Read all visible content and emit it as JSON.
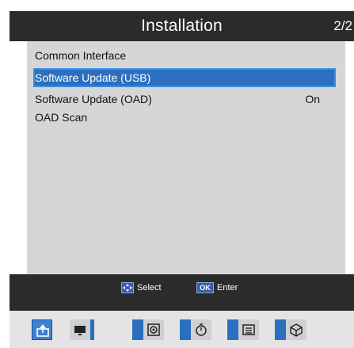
{
  "header": {
    "title": "Installation",
    "page": "2/2"
  },
  "menu": {
    "items": [
      {
        "label": "Common Interface",
        "value": ""
      },
      {
        "label": "Software Update (USB)",
        "value": ""
      },
      {
        "label": "Software Update (OAD)",
        "value": "On"
      },
      {
        "label": "OAD Scan",
        "value": ""
      }
    ],
    "selected_index": 1
  },
  "hints": [
    {
      "key_icon": "navigation-arrows-icon",
      "text": "Select"
    },
    {
      "key": "OK",
      "text": "Enter"
    }
  ],
  "categories": [
    {
      "icon": "installation-icon",
      "active": true
    },
    {
      "icon": "monitor-icon",
      "active": false
    },
    {
      "icon": "speaker-icon",
      "active": false
    },
    {
      "icon": "timer-icon",
      "active": false
    },
    {
      "icon": "list-icon",
      "active": false
    },
    {
      "icon": "cube-icon",
      "active": false
    }
  ],
  "colors": {
    "selection": "#2c6fbf",
    "panel": "#d6d6d6",
    "bars": "#2b2b2b"
  }
}
